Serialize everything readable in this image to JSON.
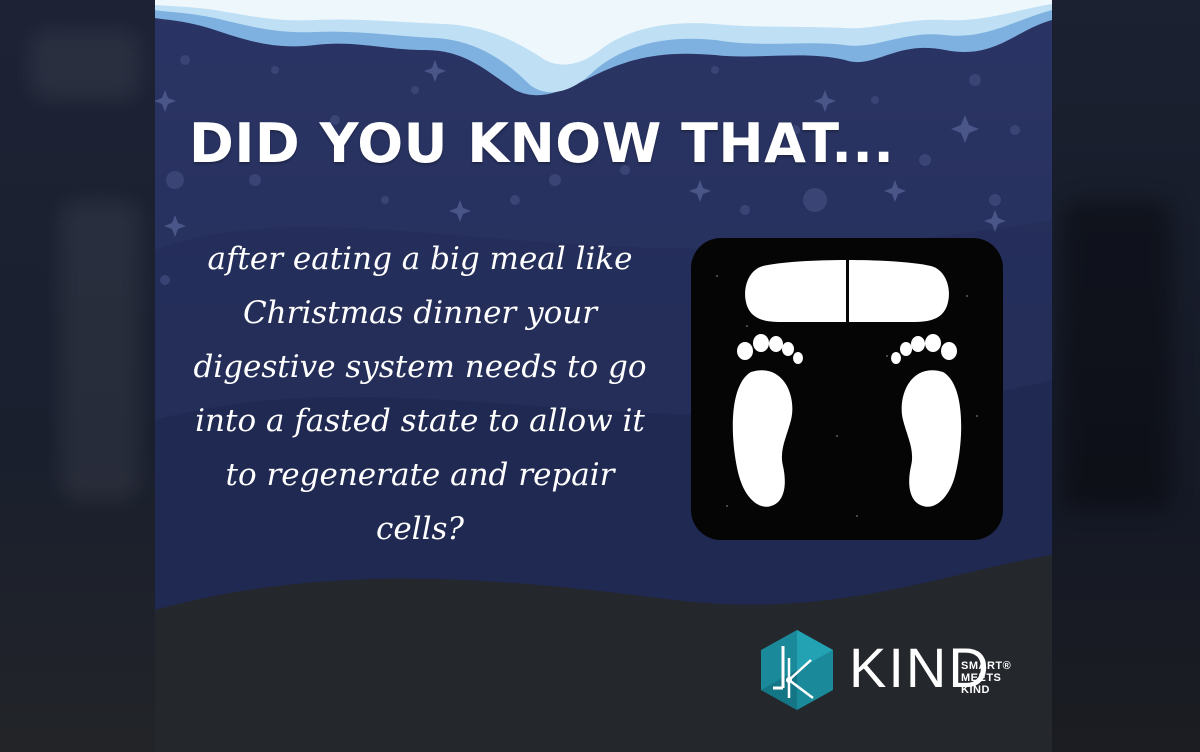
{
  "headline": "DID YOU KNOW THAT...",
  "body_lines": [
    "after eating a big meal like",
    "Christmas dinner your",
    "digestive system needs to go",
    "into a fasted state to allow it",
    "to regenerate and repair",
    "cells?"
  ],
  "logo": {
    "word": "KIND",
    "tagline": [
      "SMART®",
      "MEETS",
      "KIND"
    ]
  },
  "icons": {
    "scale": "bathroom-scale-icon",
    "logo_mark": "kind-hexagon-logo-icon"
  },
  "colors": {
    "night_sky": "#25305a",
    "snow": "#e8f4fb",
    "ice": "#8fc3e8",
    "ground": "#24272c",
    "scale_bg": "#050505",
    "logo_teal": "#1a8a9a"
  }
}
